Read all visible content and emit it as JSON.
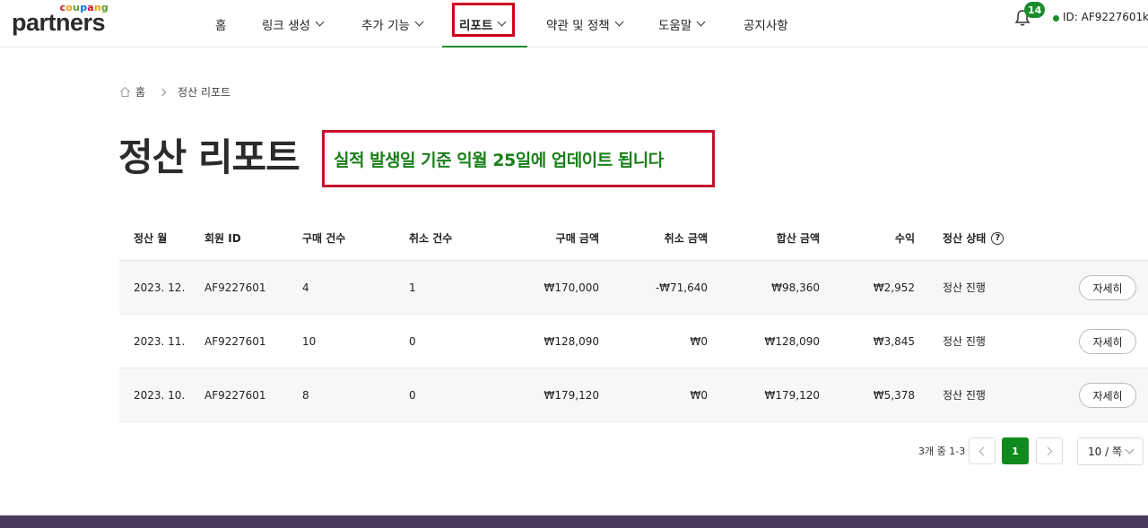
{
  "brand": {
    "sub": "coupang",
    "name": "partners"
  },
  "nav": {
    "items": [
      {
        "label": "홈",
        "has_dropdown": false
      },
      {
        "label": "링크 생성",
        "has_dropdown": true
      },
      {
        "label": "추가 기능",
        "has_dropdown": true
      },
      {
        "label": "리포트",
        "has_dropdown": true,
        "active": true
      },
      {
        "label": "약관 및 정책",
        "has_dropdown": true
      },
      {
        "label": "도움말",
        "has_dropdown": true
      },
      {
        "label": "공지사항",
        "has_dropdown": false
      }
    ],
    "notification_count": "14",
    "user_id": "ID: AF9227601",
    "user_id_cut": "k",
    "accent_color": "#1a8c2e"
  },
  "breadcrumb": {
    "home": "홈",
    "current": "정산 리포트"
  },
  "page": {
    "title": "정산 리포트",
    "notice": "실적 발생일 기준 익월 25일에 업데이트 됩니다"
  },
  "table": {
    "headers": {
      "month": "정산 월",
      "member_id": "회원 ID",
      "purchase_count": "구매 건수",
      "cancel_count": "취소 건수",
      "purchase_amount": "구매 금액",
      "cancel_amount": "취소 금액",
      "total_amount": "합산 금액",
      "revenue": "수익",
      "status": "정산 상태",
      "help": "?"
    },
    "rows": [
      {
        "month": "2023. 12.",
        "member_id": "AF9227601",
        "purchase_count": "4",
        "cancel_count": "1",
        "purchase_amount": "₩170,000",
        "cancel_amount": "-₩71,640",
        "total_amount": "₩98,360",
        "revenue": "₩2,952",
        "status": "정산 진행",
        "action": "자세히"
      },
      {
        "month": "2023. 11.",
        "member_id": "AF9227601",
        "purchase_count": "10",
        "cancel_count": "0",
        "purchase_amount": "₩128,090",
        "cancel_amount": "₩0",
        "total_amount": "₩128,090",
        "revenue": "₩3,845",
        "status": "정산 진행",
        "action": "자세히"
      },
      {
        "month": "2023. 10.",
        "member_id": "AF9227601",
        "purchase_count": "8",
        "cancel_count": "0",
        "purchase_amount": "₩179,120",
        "cancel_amount": "₩0",
        "total_amount": "₩179,120",
        "revenue": "₩5,378",
        "status": "정산 진행",
        "action": "자세히"
      }
    ]
  },
  "pagination": {
    "total_text": "3개 중 1-3",
    "current_page": "1",
    "page_size": "10 / 쪽"
  }
}
